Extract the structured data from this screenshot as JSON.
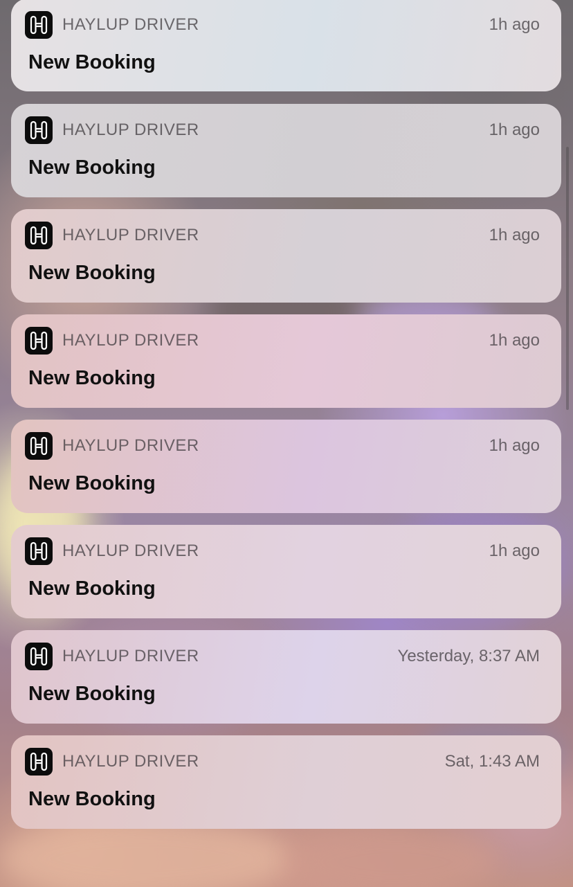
{
  "notifications": [
    {
      "app_name": "HAYLUP DRIVER",
      "timestamp": "1h ago",
      "title": "New Booking",
      "icon": "haylup-h-logo-icon",
      "tint": [
        "#e6e1e3",
        "#d9e1e8",
        "#e3dcdf"
      ]
    },
    {
      "app_name": "HAYLUP DRIVER",
      "timestamp": "1h ago",
      "title": "New Booking",
      "icon": "haylup-h-logo-icon",
      "tint": [
        "#d7d3d6",
        "#d2cfd3",
        "#d6d0d4"
      ]
    },
    {
      "app_name": "HAYLUP DRIVER",
      "timestamp": "1h ago",
      "title": "New Booking",
      "icon": "haylup-h-logo-icon",
      "tint": [
        "#e2cbcb",
        "#d6d0d6",
        "#dccfd4"
      ]
    },
    {
      "app_name": "HAYLUP DRIVER",
      "timestamp": "1h ago",
      "title": "New Booking",
      "icon": "haylup-h-logo-icon",
      "tint": [
        "#e2c3c3",
        "#e5c8d8",
        "#ddcbd2"
      ]
    },
    {
      "app_name": "HAYLUP DRIVER",
      "timestamp": "1h ago",
      "title": "New Booking",
      "icon": "haylup-h-logo-icon",
      "tint": [
        "#e3c4c0",
        "#dcc5df",
        "#ddd0d9"
      ]
    },
    {
      "app_name": "HAYLUP DRIVER",
      "timestamp": "1h ago",
      "title": "New Booking",
      "icon": "haylup-h-logo-icon",
      "tint": [
        "#e4cccd",
        "#e2d2e0",
        "#e2d4d8"
      ]
    },
    {
      "app_name": "HAYLUP DRIVER",
      "timestamp": "Yesterday, 8:37 AM",
      "title": "New Booking",
      "icon": "haylup-h-logo-icon",
      "tint": [
        "#e0c6cd",
        "#ddd3ea",
        "#e2d2d6"
      ]
    },
    {
      "app_name": "HAYLUP DRIVER",
      "timestamp": "Sat, 1:43 AM",
      "title": "New Booking",
      "icon": "haylup-h-logo-icon",
      "tint": [
        "#e3c4c2",
        "#dfcfd6",
        "#e3cfd1"
      ]
    }
  ]
}
